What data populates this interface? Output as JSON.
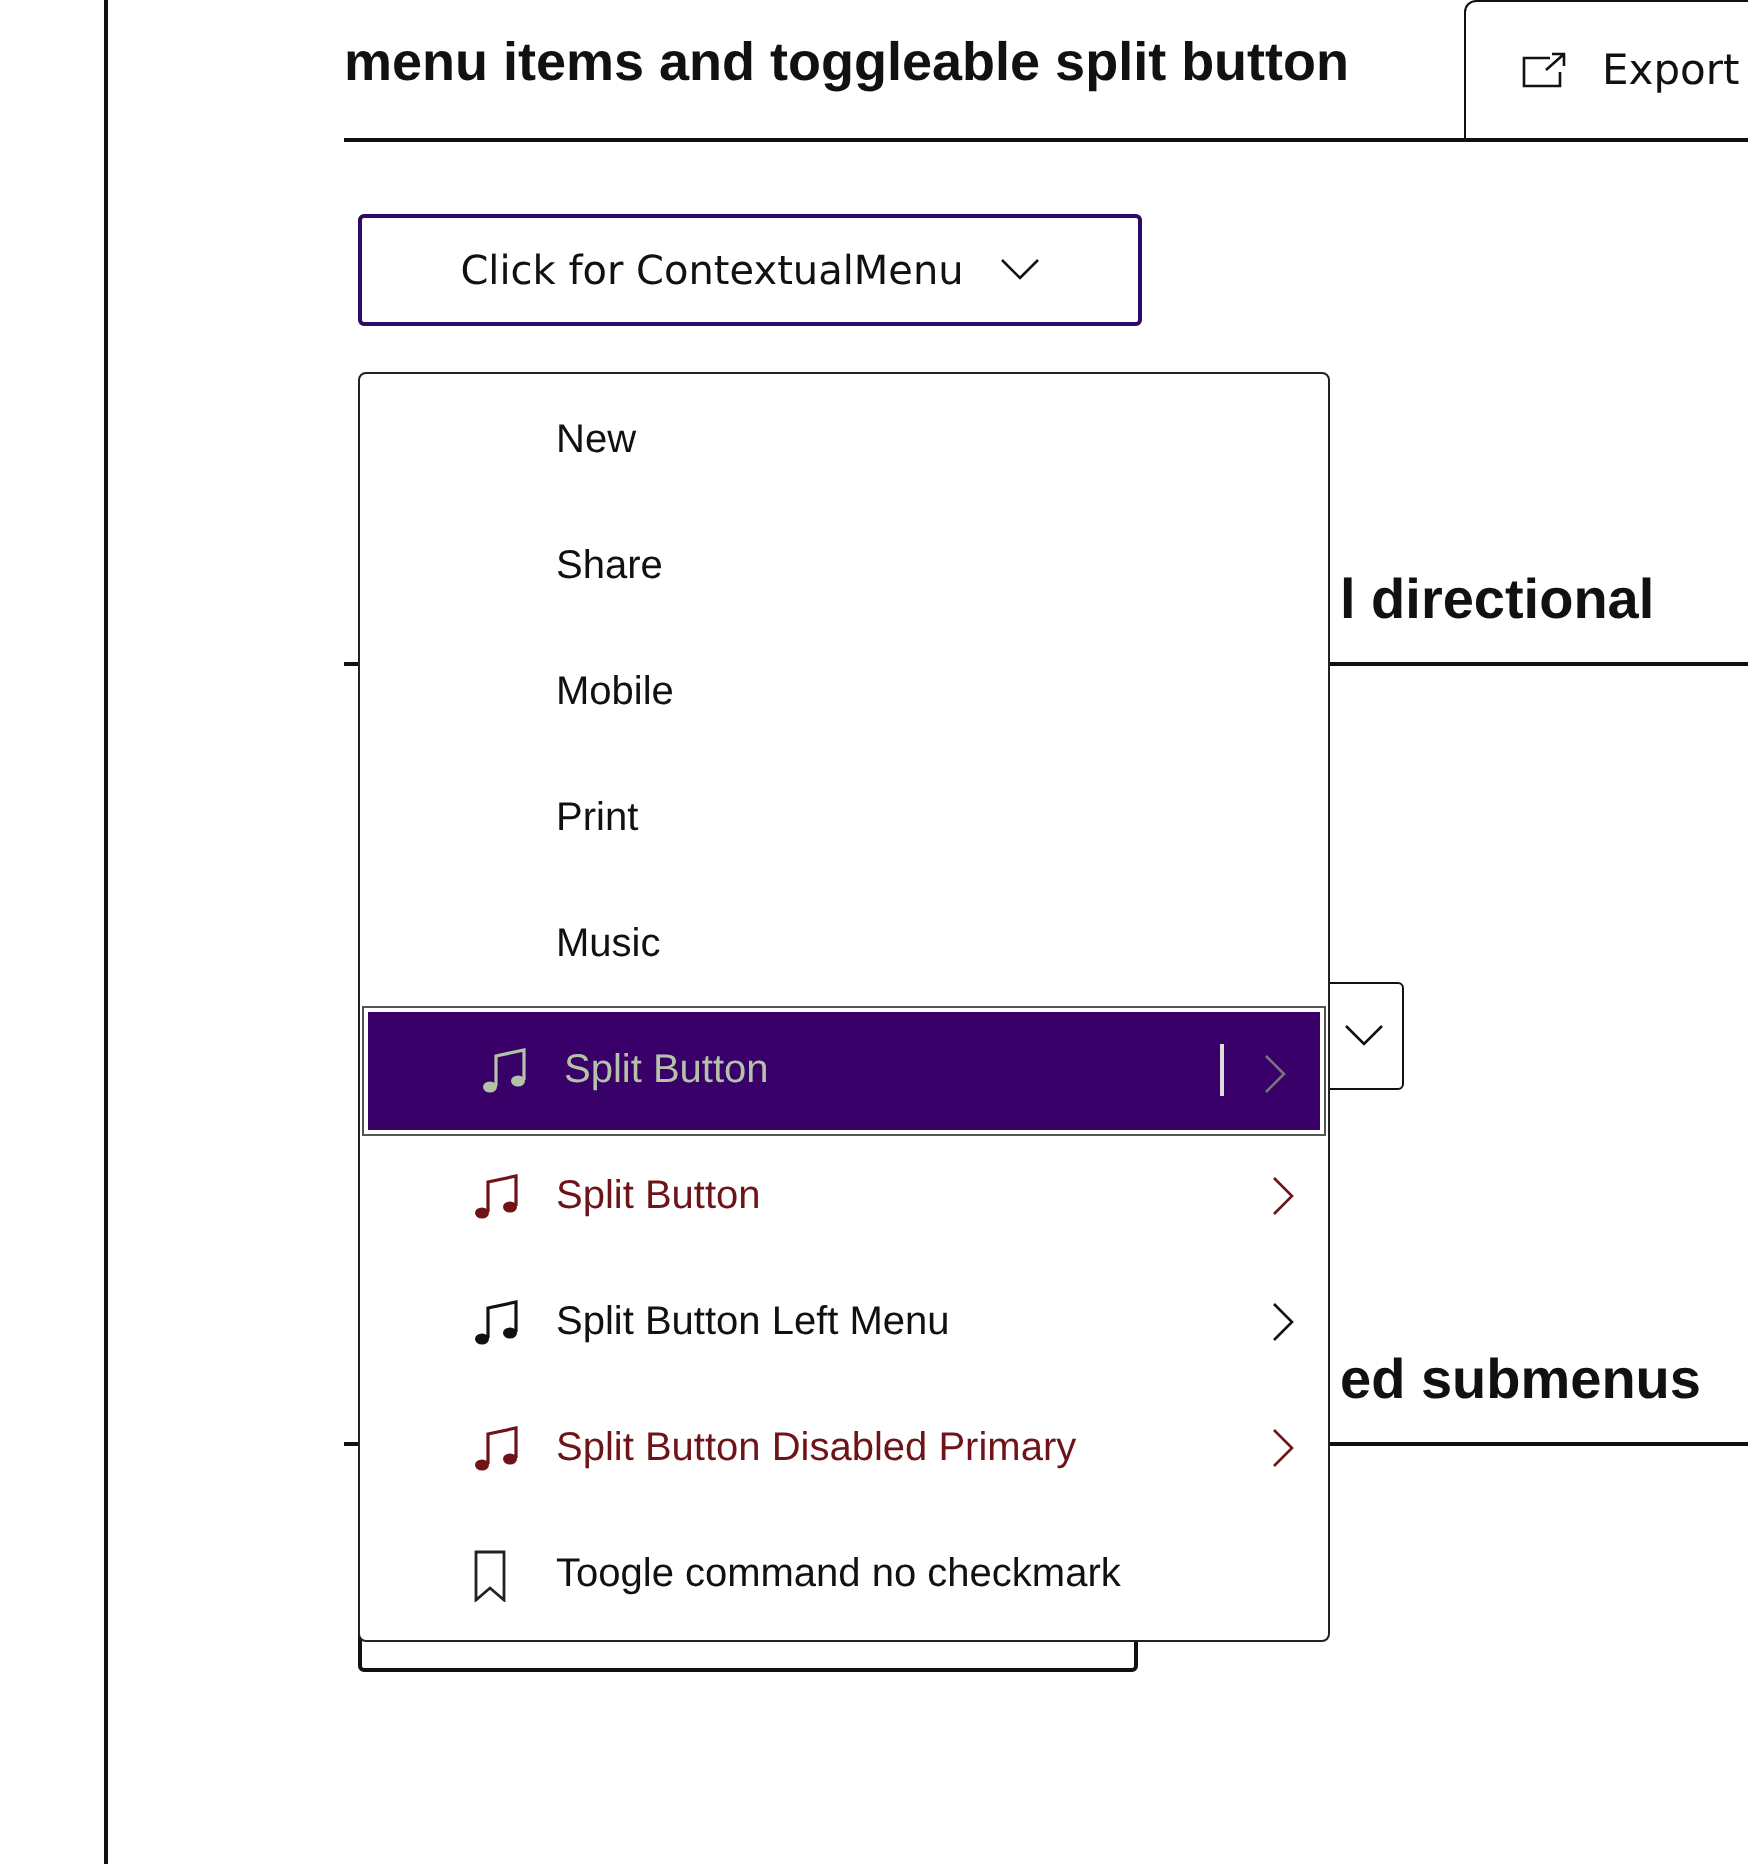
{
  "section1": {
    "heading": "menu items and toggleable split button",
    "export_button": "Export",
    "menu_button": "Click for ContextualMenu"
  },
  "section2": {
    "heading_end": "l directional"
  },
  "section3": {
    "heading_end": "ed submenus"
  },
  "menu": {
    "items": [
      {
        "kind": "plain",
        "label": "New",
        "selected": false
      },
      {
        "kind": "plain",
        "label": "Share",
        "selected": false
      },
      {
        "kind": "plain",
        "label": "Mobile",
        "selected": false
      },
      {
        "kind": "plain",
        "label": "Print",
        "selected": false
      },
      {
        "kind": "plain",
        "label": "Music",
        "selected": false
      },
      {
        "kind": "split",
        "label": "Split Button",
        "selected": true,
        "color": "#b4c2a8"
      },
      {
        "kind": "split",
        "label": "Split Button",
        "selected": false,
        "color": "#6e1418"
      },
      {
        "kind": "split",
        "label": "Split Button Left Menu",
        "selected": false,
        "color": "#111111"
      },
      {
        "kind": "split",
        "label": "Split Button Disabled Primary",
        "selected": false,
        "color": "#6e1418"
      },
      {
        "kind": "toggle",
        "label": "Toogle command no checkmark",
        "selected": false
      }
    ]
  }
}
